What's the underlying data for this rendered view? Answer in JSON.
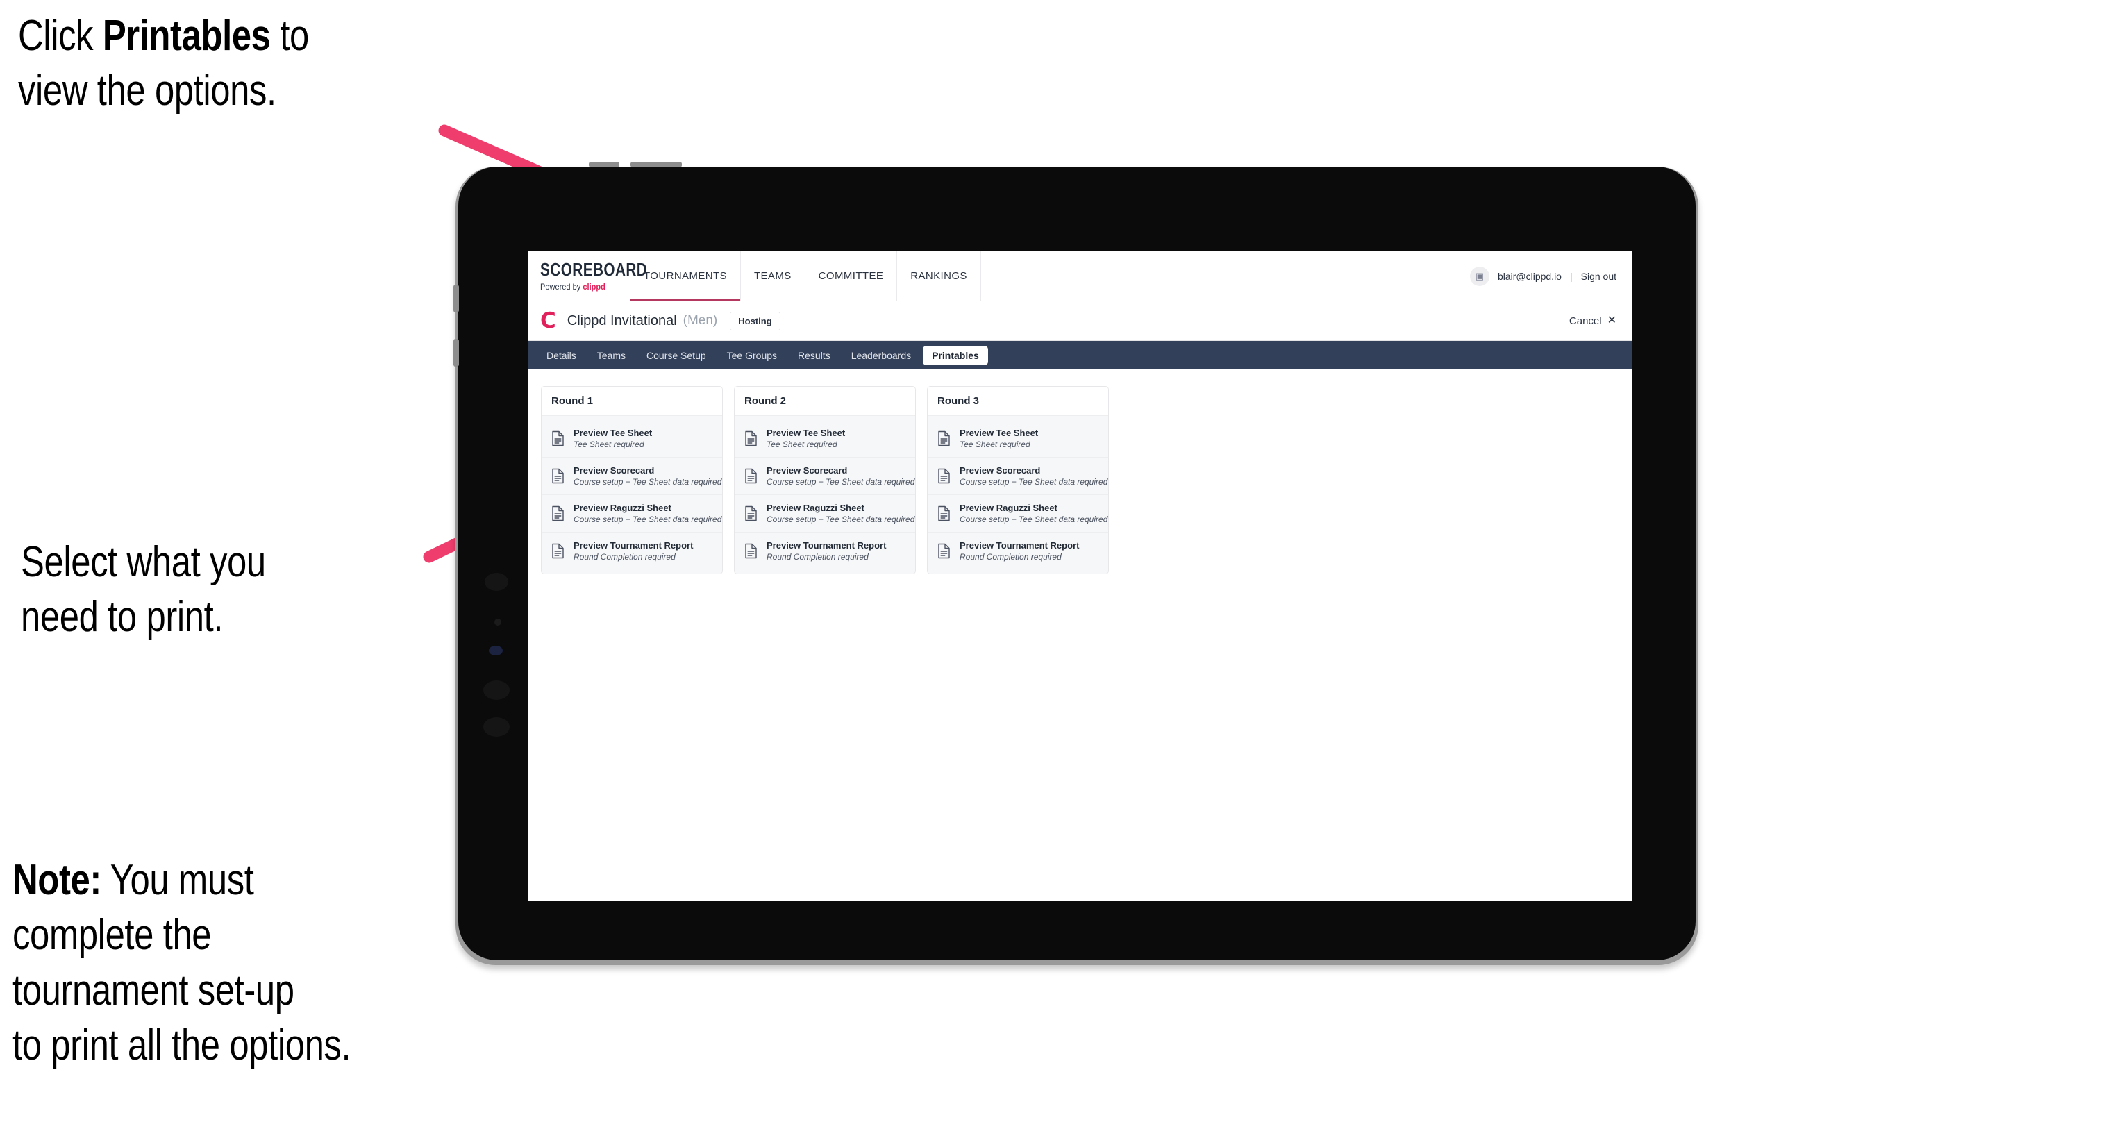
{
  "callouts": [
    {
      "id": "callout-1",
      "parts": [
        {
          "text": "Click ",
          "bold": false
        },
        {
          "text": "Printables",
          "bold": true
        },
        {
          "text": " to\nview the options.",
          "bold": false
        }
      ]
    },
    {
      "id": "callout-2",
      "parts": [
        {
          "text": "Select what you\n need to print.",
          "bold": false
        }
      ]
    },
    {
      "id": "callout-3",
      "parts": [
        {
          "text": "Note:",
          "bold": true
        },
        {
          "text": " You must\ncomplete the\ntournament set-up\nto print all the options.",
          "bold": false
        }
      ]
    }
  ],
  "colors": {
    "arrow_pink": "#ef3e6d",
    "brand_accent": "#e1215b",
    "nav_bar_dark": "#334059",
    "tab_underline": "#b4385f"
  },
  "app": {
    "brand": {
      "title": "SCOREBOARD",
      "powered_prefix": "Powered by ",
      "powered_brand": "clippd"
    },
    "top_nav": {
      "items": [
        {
          "label": "TOURNAMENTS",
          "active": true
        },
        {
          "label": "TEAMS",
          "active": false
        },
        {
          "label": "COMMITTEE",
          "active": false
        },
        {
          "label": "RANKINGS",
          "active": false
        }
      ],
      "account": {
        "avatar_icon": "user-avatar-icon",
        "email": "blair@clippd.io",
        "separator": "|",
        "sign_out": "Sign out"
      }
    },
    "tournament": {
      "logo_letter": "C",
      "name": "Clippd Invitational",
      "gender": "(Men)",
      "hosting_badge": "Hosting",
      "cancel_label": "Cancel",
      "cancel_icon": "close-x-icon"
    },
    "section_tabs": [
      {
        "label": "Details",
        "selected": false
      },
      {
        "label": "Teams",
        "selected": false
      },
      {
        "label": "Course Setup",
        "selected": false
      },
      {
        "label": "Tee Groups",
        "selected": false
      },
      {
        "label": "Results",
        "selected": false
      },
      {
        "label": "Leaderboards",
        "selected": false
      },
      {
        "label": "Printables",
        "selected": true
      }
    ],
    "rounds": [
      {
        "header": "Round 1",
        "items": [
          {
            "title": "Preview Tee Sheet",
            "subtitle": "Tee Sheet required"
          },
          {
            "title": "Preview Scorecard",
            "subtitle": "Course setup + Tee Sheet data required"
          },
          {
            "title": "Preview Raguzzi Sheet",
            "subtitle": "Course setup + Tee Sheet data required"
          },
          {
            "title": "Preview Tournament Report",
            "subtitle": "Round Completion required"
          }
        ]
      },
      {
        "header": "Round 2",
        "items": [
          {
            "title": "Preview Tee Sheet",
            "subtitle": "Tee Sheet required"
          },
          {
            "title": "Preview Scorecard",
            "subtitle": "Course setup + Tee Sheet data required"
          },
          {
            "title": "Preview Raguzzi Sheet",
            "subtitle": "Course setup + Tee Sheet data required"
          },
          {
            "title": "Preview Tournament Report",
            "subtitle": "Round Completion required"
          }
        ]
      },
      {
        "header": "Round 3",
        "items": [
          {
            "title": "Preview Tee Sheet",
            "subtitle": "Tee Sheet required"
          },
          {
            "title": "Preview Scorecard",
            "subtitle": "Course setup + Tee Sheet data required"
          },
          {
            "title": "Preview Raguzzi Sheet",
            "subtitle": "Course setup + Tee Sheet data required"
          },
          {
            "title": "Preview Tournament Report",
            "subtitle": "Round Completion required"
          }
        ]
      }
    ]
  }
}
